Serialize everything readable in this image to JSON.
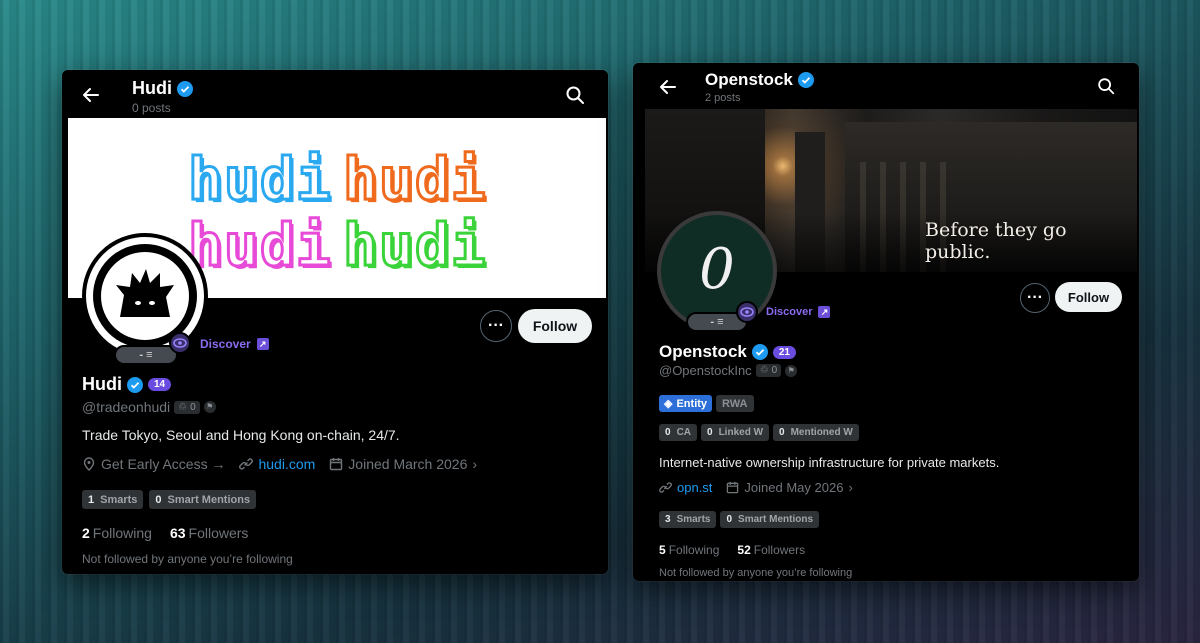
{
  "hudi": {
    "header": {
      "title": "Hudi",
      "subtitle": "0 posts"
    },
    "banner": {
      "words": [
        "hudi",
        "hudi",
        "hudi",
        "hudi"
      ],
      "colors": [
        "#2aa8f0",
        "#f06a1e",
        "#e84ad8",
        "#3ad43a"
      ]
    },
    "avatar_badge": "- ≡",
    "discover_label": "Discover",
    "follow_label": "Follow",
    "name": "Hudi",
    "count_badge": "14",
    "handle": "@tradeonhudi",
    "handle_chip_count": "0",
    "bio": "Trade Tokyo, Seoul and Hong Kong on-chain, 24/7.",
    "meta": {
      "location": "Get Early Access →",
      "link": "hudi.com",
      "joined": "Joined March 2026"
    },
    "chips": [
      {
        "num": "1",
        "label": "Smarts"
      },
      {
        "num": "0",
        "label": "Smart Mentions"
      }
    ],
    "following_count": "2",
    "following_label": "Following",
    "followers_count": "63",
    "followers_label": "Followers",
    "followed_note": "Not followed by anyone you’re following"
  },
  "openstock": {
    "header": {
      "title": "Openstock",
      "subtitle": "2 posts"
    },
    "banner_text": "Before they go public.",
    "avatar_letter": "0",
    "avatar_badge": "- ≡",
    "discover_label": "Discover",
    "follow_label": "Follow",
    "name": "Openstock",
    "count_badge": "21",
    "handle": "@OpenstockInc",
    "handle_chip_count": "0",
    "tags": {
      "entity": "Entity",
      "rwa": "RWA"
    },
    "stats_chips": [
      {
        "num": "0",
        "label": "CA"
      },
      {
        "num": "0",
        "label": "Linked W"
      },
      {
        "num": "0",
        "label": "Mentioned W"
      }
    ],
    "bio": "Internet-native ownership infrastructure for private markets.",
    "meta": {
      "link": "opn.st",
      "joined": "Joined May 2026"
    },
    "chips": [
      {
        "num": "3",
        "label": "Smarts"
      },
      {
        "num": "0",
        "label": "Smart Mentions"
      }
    ],
    "following_count": "5",
    "following_label": "Following",
    "followers_count": "52",
    "followers_label": "Followers",
    "followed_note": "Not followed by anyone you’re following"
  },
  "colors": {
    "accent_blue": "#1d9bf0",
    "discover_purple": "#8b6cf0",
    "badge_purple": "#6a4de0"
  }
}
